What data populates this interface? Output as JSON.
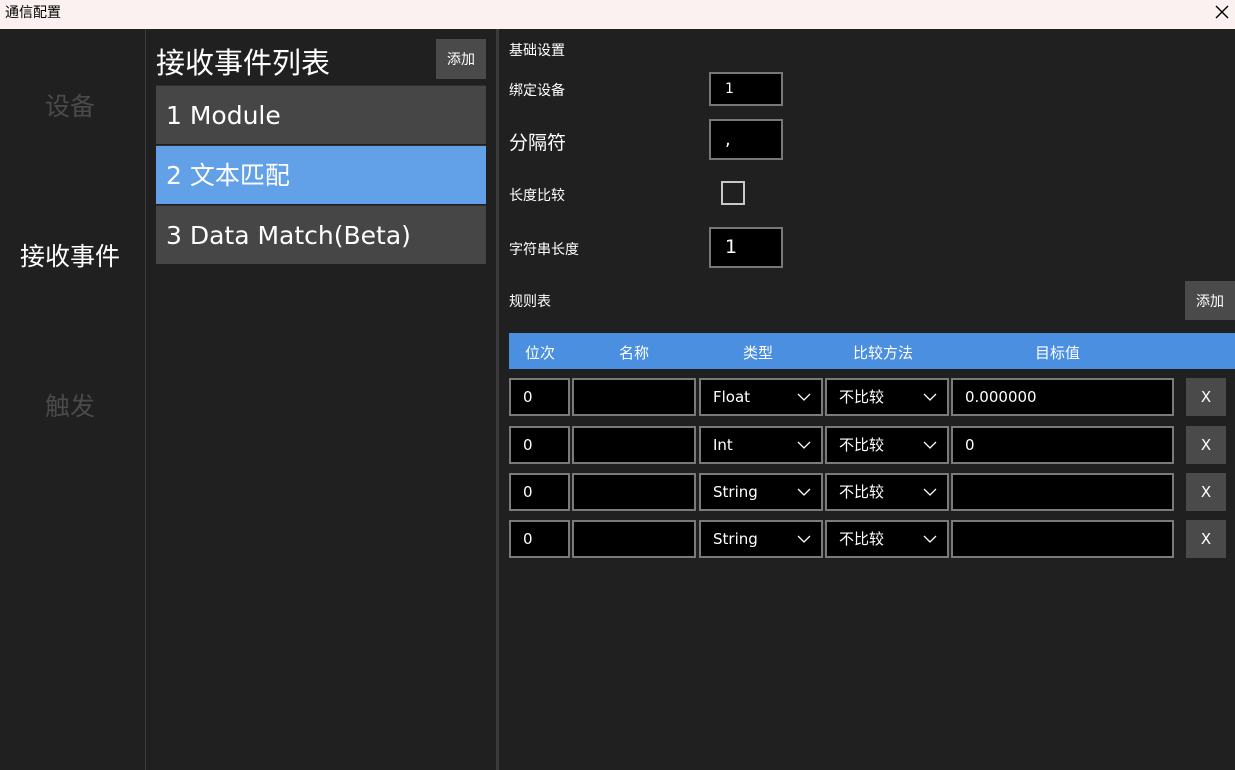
{
  "window": {
    "title": "通信配置"
  },
  "nav": {
    "items": [
      "设备",
      "接收事件",
      "触发"
    ],
    "active": "接收事件"
  },
  "event_list": {
    "title": "接收事件列表",
    "add_label": "添加",
    "items": [
      "1 Module",
      "2 文本匹配",
      "3 Data Match(Beta)"
    ],
    "selected": "2 文本匹配"
  },
  "basic": {
    "section_title": "基础设置",
    "bind_device_label": "绑定设备",
    "bind_device_value": "1",
    "separator_label": "分隔符",
    "separator_value": ",",
    "length_compare_label": "长度比较",
    "length_compare_checked": false,
    "string_length_label": "字符串长度",
    "string_length_value": "1"
  },
  "rules": {
    "title": "规则表",
    "add_label": "添加",
    "columns": [
      "位次",
      "名称",
      "类型",
      "比较方法",
      "目标值"
    ],
    "rows": [
      {
        "pos": "0",
        "name": "",
        "type": "Float",
        "method": "不比较",
        "target": "0.000000"
      },
      {
        "pos": "0",
        "name": "",
        "type": "Int",
        "method": "不比较",
        "target": "0"
      },
      {
        "pos": "0",
        "name": "",
        "type": "String",
        "method": "不比较",
        "target": ""
      },
      {
        "pos": "0",
        "name": "",
        "type": "String",
        "method": "不比较",
        "target": ""
      }
    ],
    "delete_label": "X"
  },
  "colors": {
    "accent": "#62a0e8",
    "header": "#4a8fe0",
    "bg": "#202020"
  }
}
